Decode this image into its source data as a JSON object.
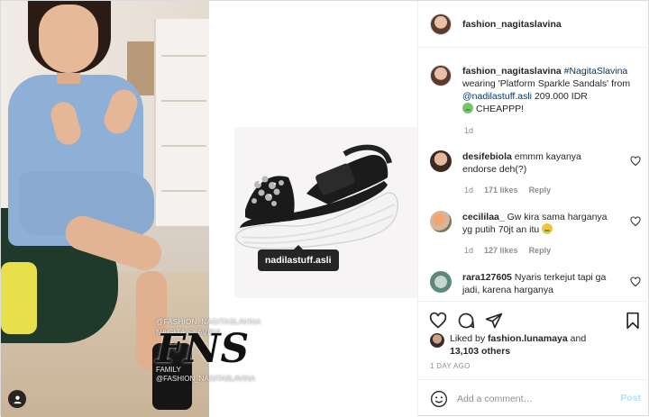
{
  "media": {
    "watermark_top": "@FASHION_NAGITASLAVINA",
    "watermark_name": "NAGITA SLAVINA",
    "watermark_logo": "FNS",
    "watermark_family": "FAMILY",
    "watermark_bottom": "@FASHION_NAGITASLAVINA",
    "product_tag": "nadilastuff.asli"
  },
  "header": {
    "username": "fashion_nagitaslavina"
  },
  "caption": {
    "username": "fashion_nagitaslavina",
    "hashtag": "#NagitaSlavina",
    "text_1": "wearing 'Platform Sparkle Sandals' from",
    "mention": "@nadilastuff.asli",
    "text_2": "209.000 IDR",
    "text_3": "CHEAPPP!",
    "time": "1d"
  },
  "comments": [
    {
      "username": "desifebiola",
      "text": "emmm kayanya endorse deh(?)",
      "time": "1d",
      "likes": "171 likes",
      "reply": "Reply"
    },
    {
      "username": "cecililaa_",
      "text": "Gw kira sama harganya yg putih 70jt an itu",
      "time": "1d",
      "likes": "127 likes",
      "reply": "Reply"
    },
    {
      "username": "rara127605",
      "text": "Nyaris terkejut tapi ga jadi, karena harganya"
    }
  ],
  "likes": {
    "prefix": "Liked by",
    "user": "fashion.lunamaya",
    "middle": "and",
    "others": "13,103 others"
  },
  "time_ago": "1 DAY AGO",
  "add_comment": {
    "placeholder": "Add a comment…",
    "post_label": "Post"
  },
  "colors": {
    "link": "#00376b",
    "muted": "#8e8e8e",
    "border": "#dbdbdb",
    "post_disabled": "#b2dffc"
  }
}
